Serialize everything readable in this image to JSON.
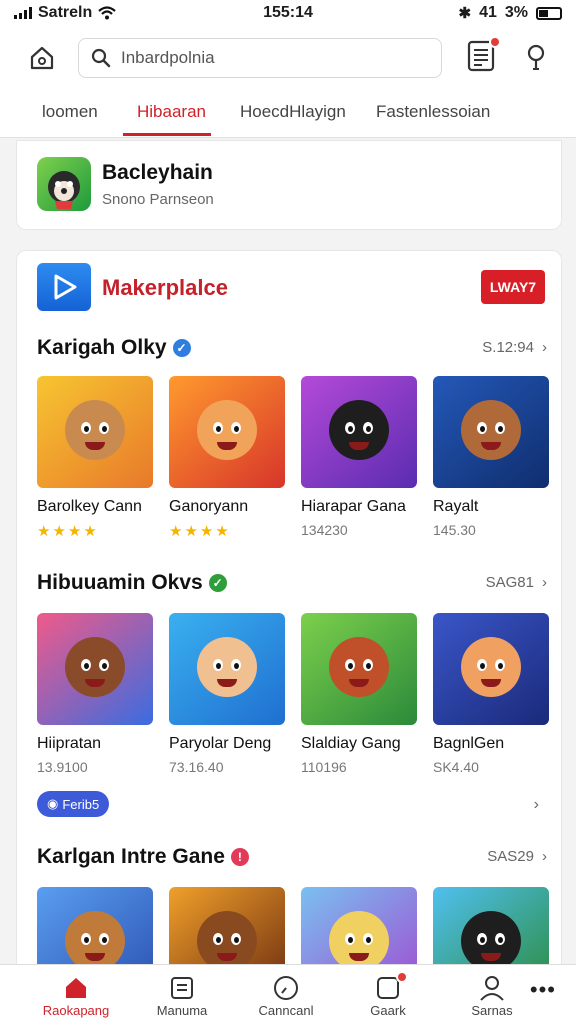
{
  "status_bar": {
    "carrier": "Satreln",
    "time": "155:14",
    "signal_text": "41",
    "battery_text": "3%"
  },
  "header": {
    "search_placeholder": "Inbardpolnia",
    "tabs": [
      {
        "label": "loomen"
      },
      {
        "label": "Hibaaran"
      },
      {
        "label": "HoecdHlayign"
      },
      {
        "label": "Fastenlessoian"
      }
    ]
  },
  "featured": {
    "title": "Bacleyhain",
    "subtitle": "Snono Parnseon"
  },
  "marketplace": {
    "title": "Makerplalce",
    "button_label": "LWAY7"
  },
  "sections": [
    {
      "title": "Karigah Olky",
      "count": "S.12:94",
      "badge_color": "#2f7de0",
      "games": [
        {
          "name": "Barolkey Cann",
          "meta": "",
          "stars": "★★★★",
          "bg1": "#f7c531",
          "bg2": "#e8792a",
          "face": "#c98a50"
        },
        {
          "name": "Ganoryann",
          "meta": "",
          "stars": "★★★★",
          "bg1": "#ff9a2e",
          "bg2": "#d7352a",
          "face": "#f2a35a"
        },
        {
          "name": "Hiarapar Gana",
          "meta": "134230",
          "stars": "",
          "bg1": "#b44ad8",
          "bg2": "#5a2cb0",
          "face": "#1e1e1e"
        },
        {
          "name": "Rayalt",
          "meta": "145.30",
          "stars": "",
          "bg1": "#2458b8",
          "bg2": "#0f2e6e",
          "face": "#b06a3a"
        }
      ]
    },
    {
      "title": "Hibuuamin Okvs",
      "count": "SAG81",
      "badge_color": "#2e9e3a",
      "games": [
        {
          "name": "Hiipratan",
          "meta": "13.9100",
          "stars": "",
          "bg1": "#f05a8a",
          "bg2": "#3a6ce0",
          "face": "#8a4b2a"
        },
        {
          "name": "Paryolar Deng",
          "meta": "73.16.40",
          "stars": "",
          "bg1": "#3ab0f0",
          "bg2": "#1f6fd0",
          "face": "#f0c090"
        },
        {
          "name": "Slaldiay Gang",
          "meta": "110196",
          "stars": "",
          "bg1": "#7cd04c",
          "bg2": "#2b8a3a",
          "face": "#c0502a"
        },
        {
          "name": "BagnlGen",
          "meta": "SK4.40",
          "stars": "",
          "bg1": "#3a56c8",
          "bg2": "#1a2a7a",
          "face": "#f0a060"
        }
      ]
    },
    {
      "title": "Karlgan Intre Gane",
      "count": "SAS29",
      "badge_color": "#e23b5a",
      "games": [
        {
          "name": "",
          "meta": "",
          "stars": "",
          "bg1": "#5a9ef0",
          "bg2": "#2a4fb0",
          "face": "#c07a3a"
        },
        {
          "name": "",
          "meta": "",
          "stars": "",
          "bg1": "#f0a02a",
          "bg2": "#6a2a10",
          "face": "#8a4a20"
        },
        {
          "name": "",
          "meta": "",
          "stars": "",
          "bg1": "#7ac0f0",
          "bg2": "#a04ad0",
          "face": "#f0d060"
        },
        {
          "name": "",
          "meta": "",
          "stars": "",
          "bg1": "#50c0f0",
          "bg2": "#2a8a3a",
          "face": "#1e1e1e"
        }
      ]
    }
  ],
  "chip_label": "Ferib5",
  "bottom_nav": [
    {
      "label": "Raokapang"
    },
    {
      "label": "Manuma"
    },
    {
      "label": "Canncanl"
    },
    {
      "label": "Gaark"
    },
    {
      "label": "Sarnas"
    }
  ],
  "colors": {
    "accent": "#d0222a",
    "star": "#f5b400"
  }
}
